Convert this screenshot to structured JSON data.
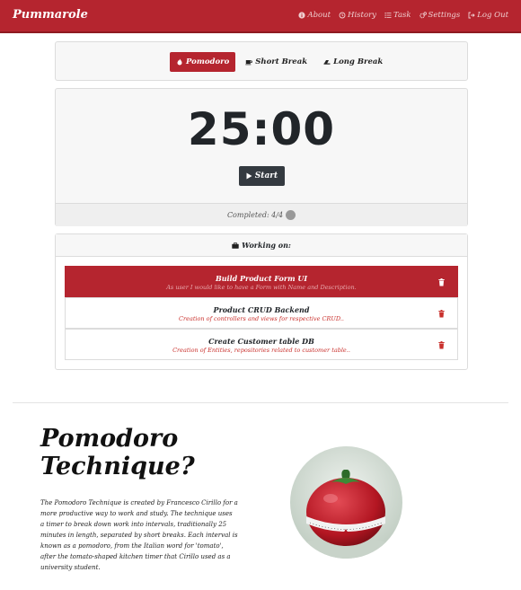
{
  "app": {
    "brand": "Pummarole"
  },
  "nav": {
    "items": [
      {
        "label": "About",
        "icon": "info-icon"
      },
      {
        "label": "History",
        "icon": "history-icon"
      },
      {
        "label": "Task",
        "icon": "list-icon"
      },
      {
        "label": "Settings",
        "icon": "gears-icon"
      },
      {
        "label": "Log Out",
        "icon": "sign-out-icon"
      }
    ]
  },
  "tabs": [
    {
      "label": "Pomodoro",
      "icon": "fire-icon",
      "active": true
    },
    {
      "label": "Short Break",
      "icon": "coffee-icon",
      "active": false
    },
    {
      "label": "Long Break",
      "icon": "couch-icon",
      "active": false
    }
  ],
  "timer": {
    "time": "25:00",
    "start_label": "Start",
    "completed_label": "Completed: 4/4"
  },
  "tasks": {
    "header": "Working on:",
    "items": [
      {
        "title": "Build Product Form UI",
        "description": "As user I would like to have a Form with Name and Description.",
        "selected": true
      },
      {
        "title": "Product CRUD Backend",
        "description": "Creation of controllers and views for respective CRUD..",
        "selected": false
      },
      {
        "title": "Create Customer table DB",
        "description": "Creation of Entities, repositories related to customer table..",
        "selected": false
      }
    ]
  },
  "about": {
    "title": "Pomodoro Technique?",
    "text": "The Pomodoro Technique is created by Francesco Cirillo for a more productive way to work and study. The technique uses a timer to break down work into intervals, traditionally 25 minutes in length, separated by short breaks. Each interval is known as a pomodoro, from the Italian word for 'tomato', after the tomato-shaped kitchen timer that Cirillo used as a university student."
  },
  "colors": {
    "primary": "#b5252f",
    "dark_button": "#343a40",
    "task_desc": "#c9302c"
  }
}
